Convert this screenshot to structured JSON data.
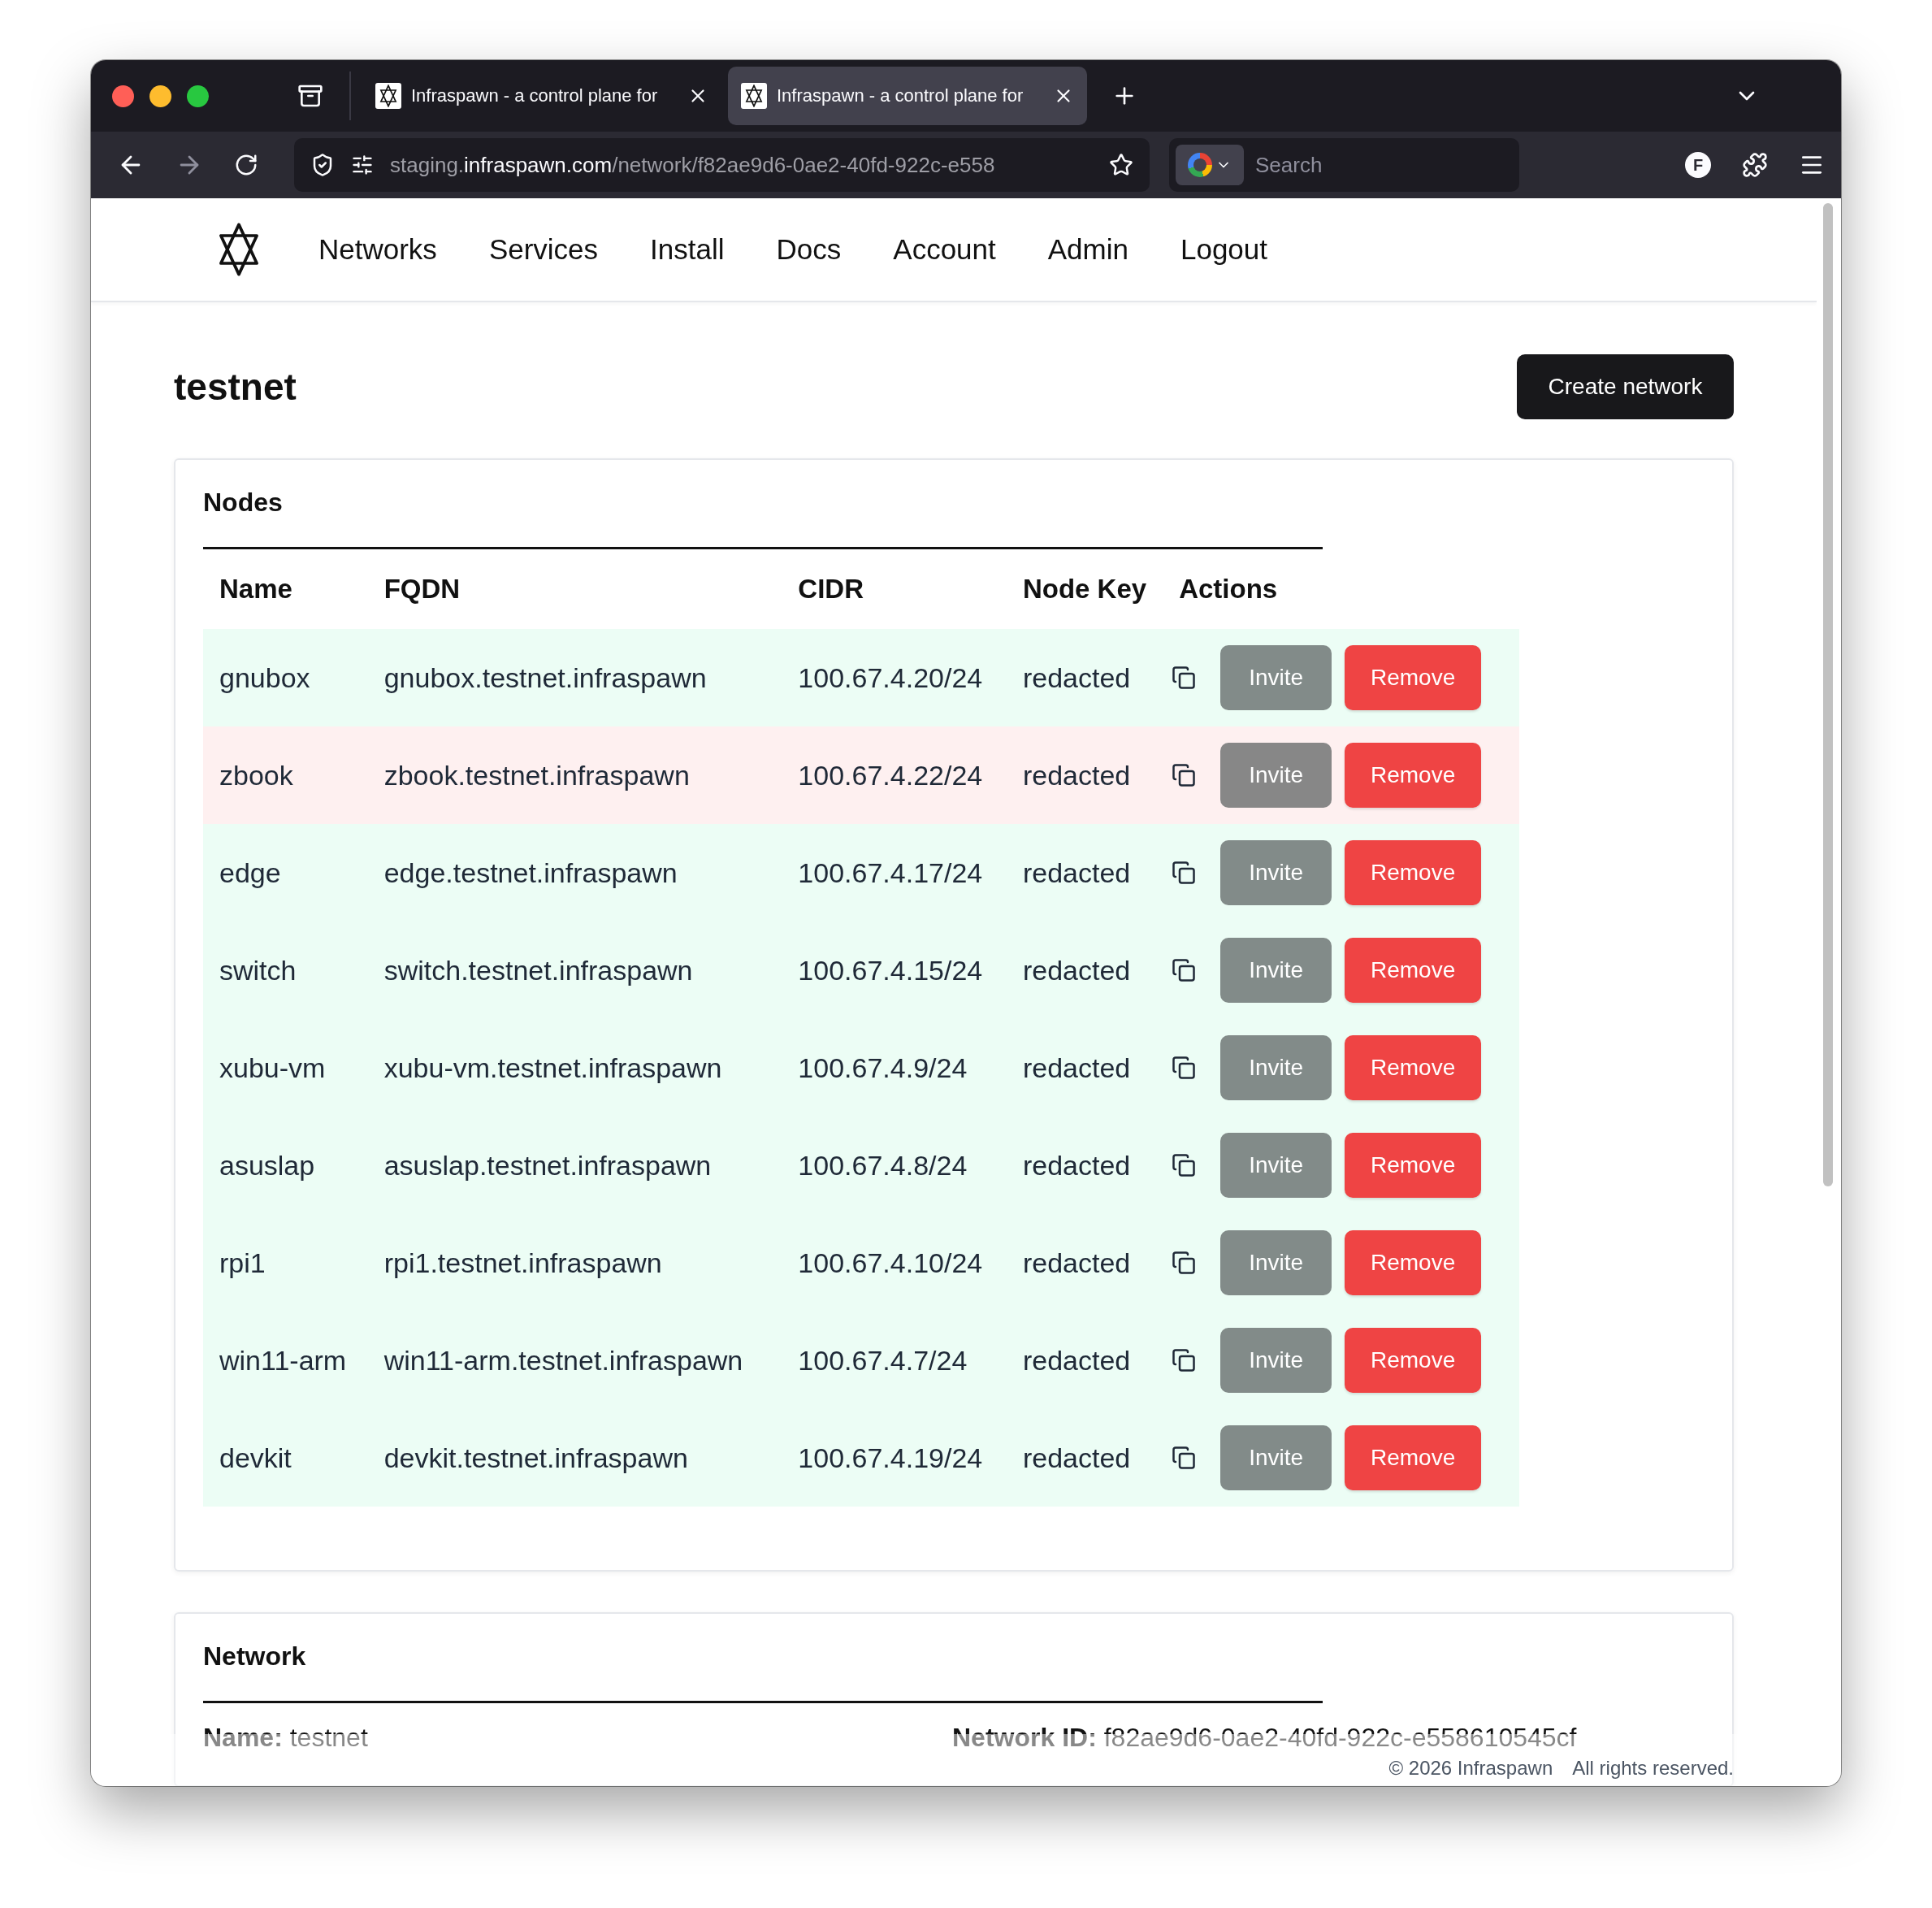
{
  "browser": {
    "tabs": [
      {
        "title": "Infraspawn - a control plane for",
        "selected": false
      },
      {
        "title": "Infraspawn - a control plane for",
        "selected": true
      }
    ],
    "url": {
      "subdomain": "staging.",
      "domain": "infraspawn.com",
      "path": "/network/f82ae9d6-0ae2-40fd-922c-e558"
    },
    "search": {
      "placeholder": "Search"
    },
    "profile_initial": "F"
  },
  "nav": {
    "items": [
      "Networks",
      "Services",
      "Install",
      "Docs",
      "Account",
      "Admin",
      "Logout"
    ]
  },
  "page": {
    "title": "testnet",
    "create_button": "Create network"
  },
  "nodes": {
    "title": "Nodes",
    "columns": [
      "Name",
      "FQDN",
      "CIDR",
      "Node Key",
      "Actions"
    ],
    "rows": [
      {
        "name": "gnubox",
        "fqdn": "gnubox.testnet.infraspawn",
        "cidr": "100.67.4.20/24",
        "node_key": "redacted",
        "online": true,
        "invite": "Invite",
        "remove": "Remove"
      },
      {
        "name": "zbook",
        "fqdn": "zbook.testnet.infraspawn",
        "cidr": "100.67.4.22/24",
        "node_key": "redacted",
        "online": false,
        "invite": "Invite",
        "remove": "Remove"
      },
      {
        "name": "edge",
        "fqdn": "edge.testnet.infraspawn",
        "cidr": "100.67.4.17/24",
        "node_key": "redacted",
        "online": true,
        "invite": "Invite",
        "remove": "Remove"
      },
      {
        "name": "switch",
        "fqdn": "switch.testnet.infraspawn",
        "cidr": "100.67.4.15/24",
        "node_key": "redacted",
        "online": true,
        "invite": "Invite",
        "remove": "Remove"
      },
      {
        "name": "xubu-vm",
        "fqdn": "xubu-vm.testnet.infraspawn",
        "cidr": "100.67.4.9/24",
        "node_key": "redacted",
        "online": true,
        "invite": "Invite",
        "remove": "Remove"
      },
      {
        "name": "asuslap",
        "fqdn": "asuslap.testnet.infraspawn",
        "cidr": "100.67.4.8/24",
        "node_key": "redacted",
        "online": true,
        "invite": "Invite",
        "remove": "Remove"
      },
      {
        "name": "rpi1",
        "fqdn": "rpi1.testnet.infraspawn",
        "cidr": "100.67.4.10/24",
        "node_key": "redacted",
        "online": true,
        "invite": "Invite",
        "remove": "Remove"
      },
      {
        "name": "win11-arm",
        "fqdn": "win11-arm.testnet.infraspawn",
        "cidr": "100.67.4.7/24",
        "node_key": "redacted",
        "online": true,
        "invite": "Invite",
        "remove": "Remove"
      },
      {
        "name": "devkit",
        "fqdn": "devkit.testnet.infraspawn",
        "cidr": "100.67.4.19/24",
        "node_key": "redacted",
        "online": true,
        "invite": "Invite",
        "remove": "Remove"
      }
    ]
  },
  "network": {
    "title": "Network",
    "fields": [
      {
        "label": "Name:",
        "value": "testnet"
      },
      {
        "label": "Network ID:",
        "value": "f82ae9d6-0ae2-40fd-922c-e558610545cf"
      }
    ]
  },
  "footer": {
    "copyright": "© 2026 Infraspawn",
    "rights": "All rights reserved."
  }
}
